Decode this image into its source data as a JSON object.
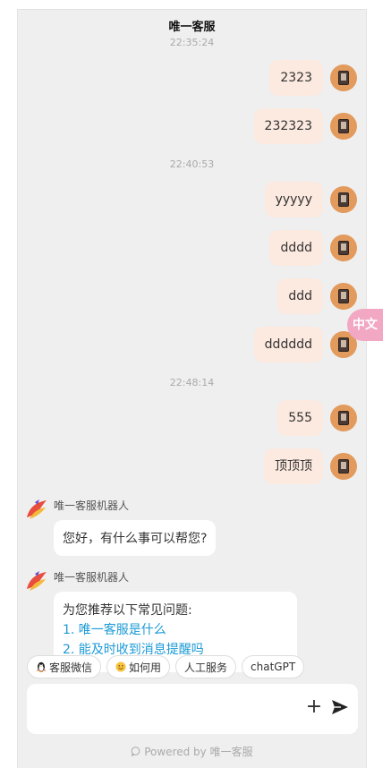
{
  "header": {
    "title": "唯一客服"
  },
  "timestamps": [
    "22:35:24",
    "22:40:53",
    "22:48:14"
  ],
  "user_messages": [
    "2323",
    "232323",
    "yyyyy",
    "dddd",
    "ddd",
    "dddddd",
    "555",
    "顶顶顶"
  ],
  "bot": {
    "name": "唯一客服机器人",
    "greeting": "您好，有什么事可以帮您?",
    "faq_intro": "为您推荐以下常见问题:",
    "faq_items": [
      "1. 唯一客服是什么",
      "2. 能及时收到消息提醒吗"
    ]
  },
  "quick_chips": [
    {
      "label": "客服微信",
      "icon": "penguin-icon"
    },
    {
      "label": "如何用",
      "icon": "smile-icon"
    },
    {
      "label": "人工服务",
      "icon": ""
    },
    {
      "label": "chatGPT",
      "icon": ""
    }
  ],
  "composer": {
    "value": "",
    "placeholder": ""
  },
  "footer": {
    "powered_by": "Powered by 唯一客服"
  },
  "floating_tab": {
    "label": "中文"
  },
  "colors": {
    "user_bubble": "#fce9df",
    "user_avatar": "#e29a5d",
    "link": "#1b9ad6",
    "panel_bg": "#efefef"
  }
}
